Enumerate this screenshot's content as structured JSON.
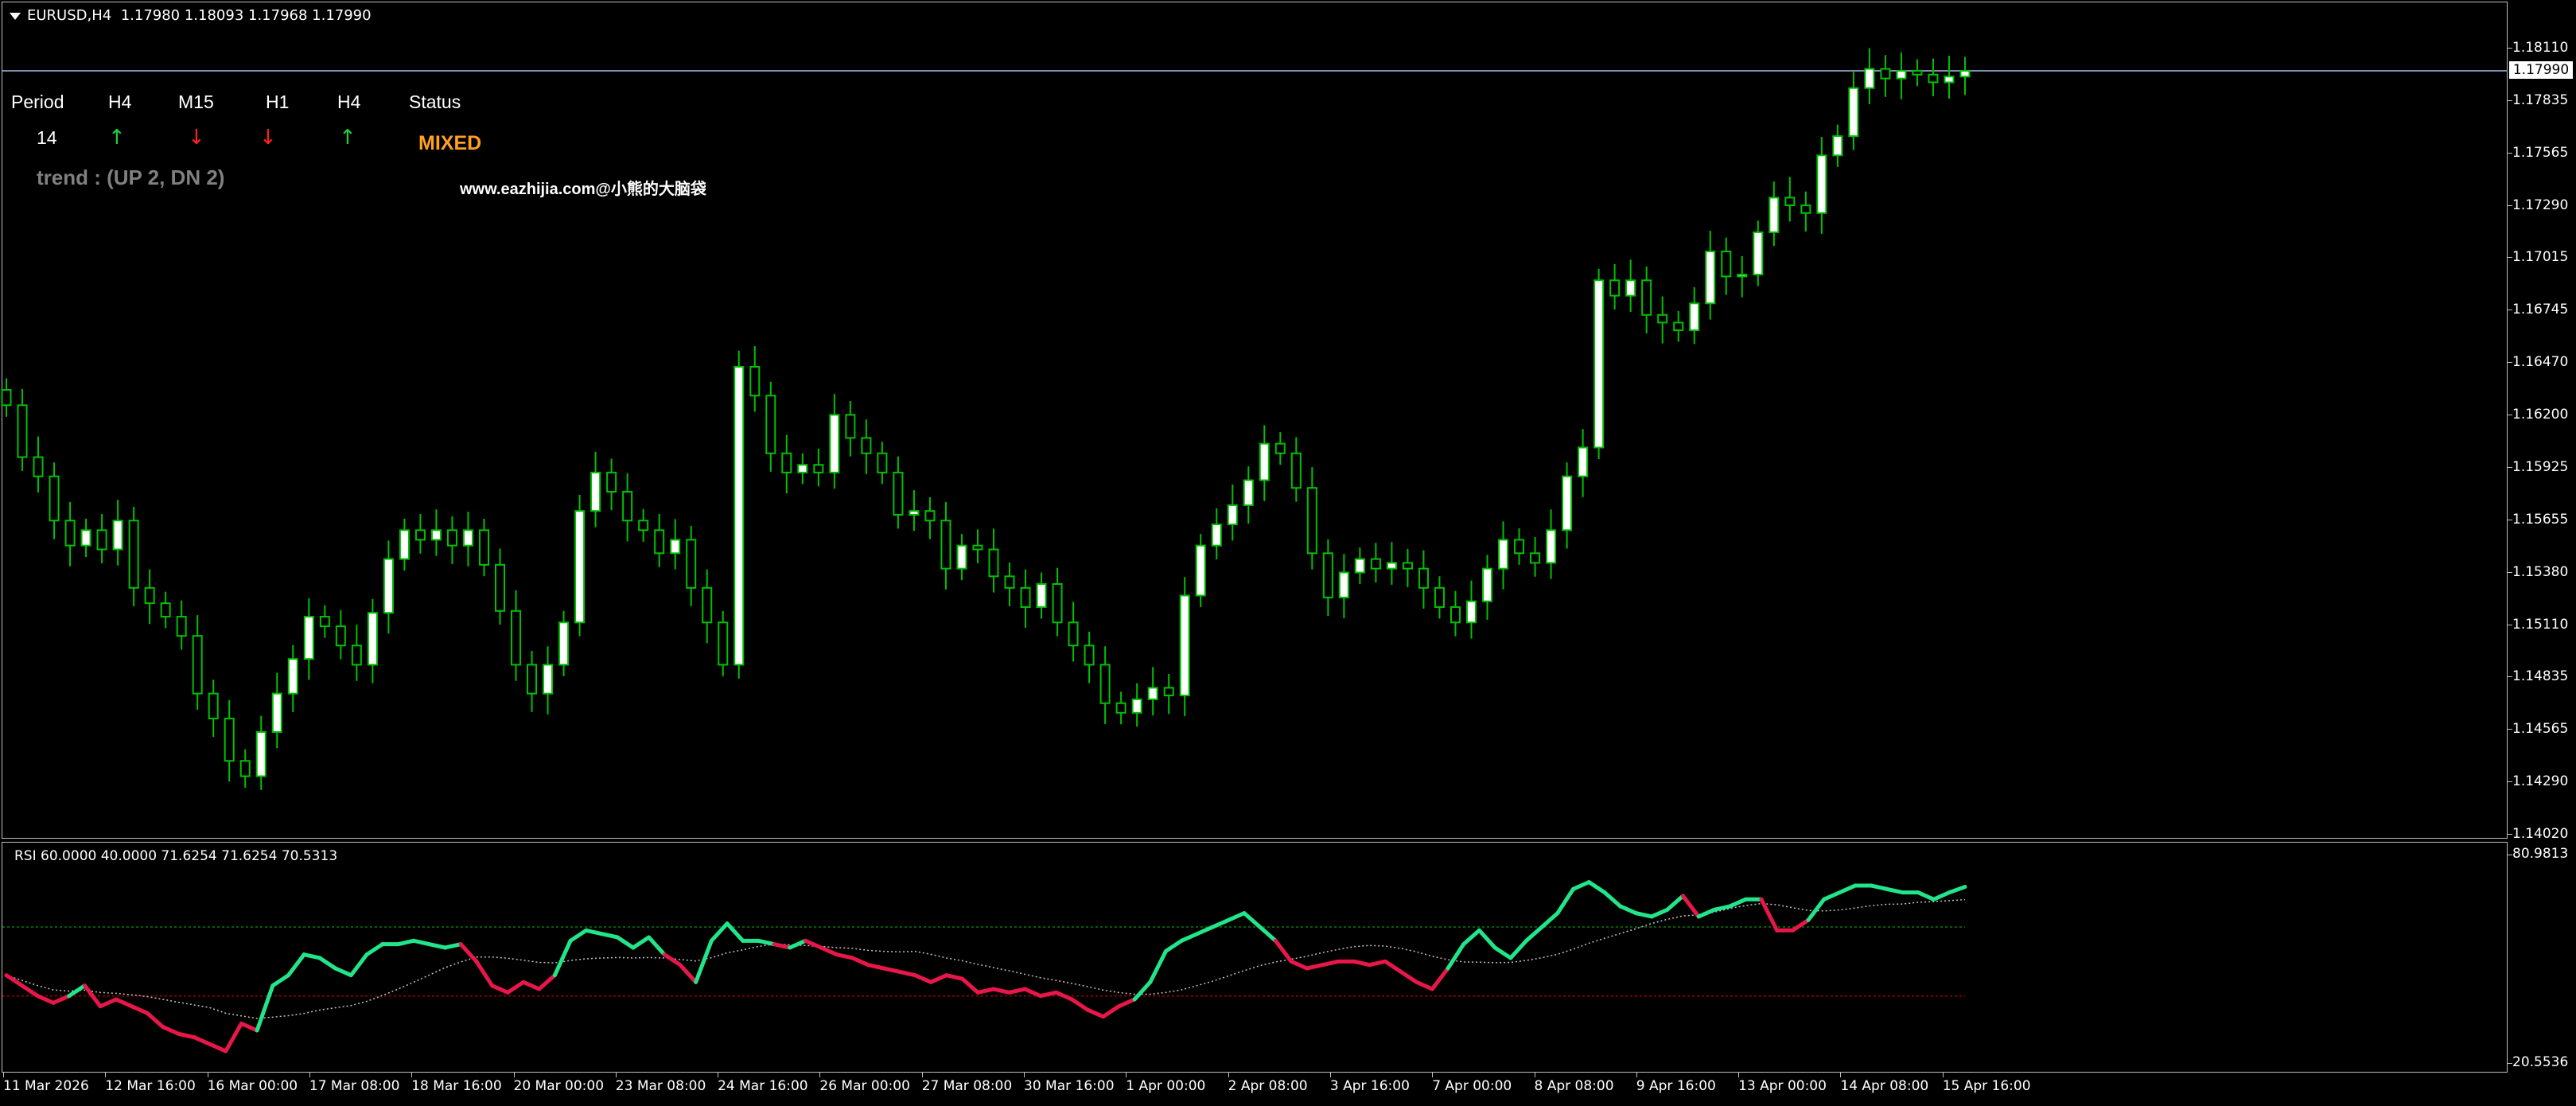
{
  "symbol_header": {
    "symbol": "EURUSD,H4",
    "ohlc": "1.17980 1.18093 1.17968 1.17990"
  },
  "price_axis": {
    "ticks": [
      "1.18110",
      "1.17835",
      "1.17565",
      "1.17290",
      "1.17015",
      "1.16745",
      "1.16470",
      "1.16200",
      "1.15925",
      "1.15655",
      "1.15380",
      "1.15110",
      "1.14835",
      "1.14565",
      "1.14290",
      "1.14020"
    ],
    "ymin": 1.1402,
    "ymax": 1.1811,
    "current_price": "1.17990"
  },
  "rsi_axis": {
    "top_label": "80.9813",
    "bottom_label": "20.5536"
  },
  "time_axis": {
    "labels": [
      "11 Mar 2026",
      "12 Mar 16:00",
      "16 Mar 00:00",
      "17 Mar 08:00",
      "18 Mar 16:00",
      "20 Mar 00:00",
      "23 Mar 08:00",
      "24 Mar 16:00",
      "26 Mar 00:00",
      "27 Mar 08:00",
      "30 Mar 16:00",
      "1 Apr 00:00",
      "2 Apr 08:00",
      "3 Apr 16:00",
      "7 Apr 00:00",
      "8 Apr 08:00",
      "9 Apr 16:00",
      "13 Apr 00:00",
      "14 Apr 08:00",
      "15 Apr 16:00"
    ]
  },
  "mtf_panel": {
    "headers": [
      "Period",
      "H4",
      "M15",
      "H1",
      "H4",
      "Status"
    ],
    "period_value": "14",
    "arrows": [
      {
        "tf": "H4",
        "direction": "up",
        "glyph": "↑",
        "color": "#20d040"
      },
      {
        "tf": "M15",
        "direction": "down",
        "glyph": "↓",
        "color": "#ff2020"
      },
      {
        "tf": "H1",
        "direction": "down",
        "glyph": "↓",
        "color": "#ff2020"
      },
      {
        "tf": "H4",
        "direction": "up",
        "glyph": "↑",
        "color": "#20d040"
      }
    ],
    "status": "MIXED",
    "status_color": "#ffa020",
    "trend_text": "trend : (UP 2, DN 2)"
  },
  "watermark": "www.eazhijia.com@小熊的大脑袋",
  "rsi_header": "RSI 60.0000 40.0000 71.6254 71.6254 70.5313",
  "colors": {
    "background": "#000000",
    "bull_body": "#ffffff",
    "wick": "#00c000",
    "rsi_up": "#22e58a",
    "rsi_down": "#e8174a",
    "rsi_ma": "#c0c0c0",
    "level_upper": "#006000",
    "level_lower": "#800000"
  },
  "chart_data": [
    {
      "type": "candlestick",
      "title": "EURUSD,H4",
      "ylim": [
        1.1402,
        1.1811
      ],
      "x_labels": [
        "11 Mar 2026",
        "12 Mar 16:00",
        "16 Mar 00:00",
        "17 Mar 08:00",
        "18 Mar 16:00",
        "20 Mar 00:00",
        "23 Mar 08:00",
        "24 Mar 16:00",
        "26 Mar 00:00",
        "27 Mar 08:00",
        "30 Mar 16:00",
        "1 Apr 00:00",
        "2 Apr 08:00",
        "3 Apr 16:00",
        "7 Apr 00:00",
        "8 Apr 08:00",
        "9 Apr 16:00",
        "13 Apr 00:00",
        "14 Apr 08:00",
        "15 Apr 16:00"
      ],
      "close": [
        1.1625,
        1.1598,
        1.1588,
        1.1565,
        1.1552,
        1.156,
        1.155,
        1.1565,
        1.153,
        1.1522,
        1.1515,
        1.1505,
        1.1475,
        1.1462,
        1.144,
        1.1432,
        1.1455,
        1.1475,
        1.1493,
        1.1515,
        1.151,
        1.15,
        1.149,
        1.1517,
        1.1545,
        1.156,
        1.1555,
        1.156,
        1.1552,
        1.156,
        1.1542,
        1.1518,
        1.149,
        1.1475,
        1.149,
        1.1512,
        1.157,
        1.159,
        1.158,
        1.1565,
        1.156,
        1.1548,
        1.1555,
        1.153,
        1.1512,
        1.149,
        1.1645,
        1.163,
        1.16,
        1.159,
        1.1594,
        1.159,
        1.162,
        1.1608,
        1.16,
        1.159,
        1.1568,
        1.157,
        1.1565,
        1.154,
        1.1552,
        1.155,
        1.1536,
        1.153,
        1.152,
        1.1532,
        1.1512,
        1.15,
        1.149,
        1.147,
        1.1465,
        1.1472,
        1.1478,
        1.1474,
        1.1526,
        1.1552,
        1.1563,
        1.1573,
        1.1586,
        1.1605,
        1.16,
        1.1582,
        1.1548,
        1.1525,
        1.1538,
        1.1545,
        1.154,
        1.1543,
        1.154,
        1.153,
        1.152,
        1.1512,
        1.1523,
        1.154,
        1.1555,
        1.1548,
        1.1543,
        1.156,
        1.1588,
        1.1603,
        1.169,
        1.1682,
        1.169,
        1.1672,
        1.1668,
        1.1664,
        1.1678,
        1.1705,
        1.1692,
        1.1693,
        1.1715,
        1.1733,
        1.1729,
        1.1725,
        1.1755,
        1.1765,
        1.179,
        1.18,
        1.1795,
        1.1799,
        1.1797,
        1.1793,
        1.1796,
        1.1799
      ]
    },
    {
      "type": "line",
      "title": "RSI 60.0000 40.0000 71.6254 71.6254 70.5313",
      "ylim": [
        20.5536,
        80.9813
      ],
      "levels": [
        60,
        40
      ],
      "series": [
        {
          "values": [
            46,
            43,
            40,
            38,
            40,
            43,
            37,
            39,
            37,
            35,
            31,
            29,
            28,
            26,
            24,
            32,
            30,
            43,
            46,
            52,
            51,
            48,
            46,
            52,
            55,
            55,
            56,
            55,
            54,
            55,
            50,
            43,
            41,
            44,
            42,
            46,
            56,
            59,
            58,
            57,
            54,
            57,
            52,
            49,
            44,
            56,
            61,
            56,
            56,
            55,
            54,
            56,
            54,
            52,
            51,
            49,
            48,
            47,
            46,
            44,
            46,
            45,
            41,
            42,
            41,
            42,
            40,
            41,
            39,
            36,
            34,
            37,
            39,
            44,
            53,
            56,
            58,
            60,
            62,
            64,
            60,
            56,
            50,
            48,
            49,
            50,
            50,
            49,
            50,
            47,
            44,
            42,
            48,
            55,
            59,
            54,
            51,
            56,
            60,
            64,
            71,
            73,
            70,
            66,
            64,
            63,
            65,
            69,
            63,
            65,
            66,
            68,
            68,
            59,
            59,
            62,
            68,
            70,
            72,
            72,
            71,
            70,
            70,
            68,
            70,
            71.6254
          ]
        }
      ]
    }
  ]
}
